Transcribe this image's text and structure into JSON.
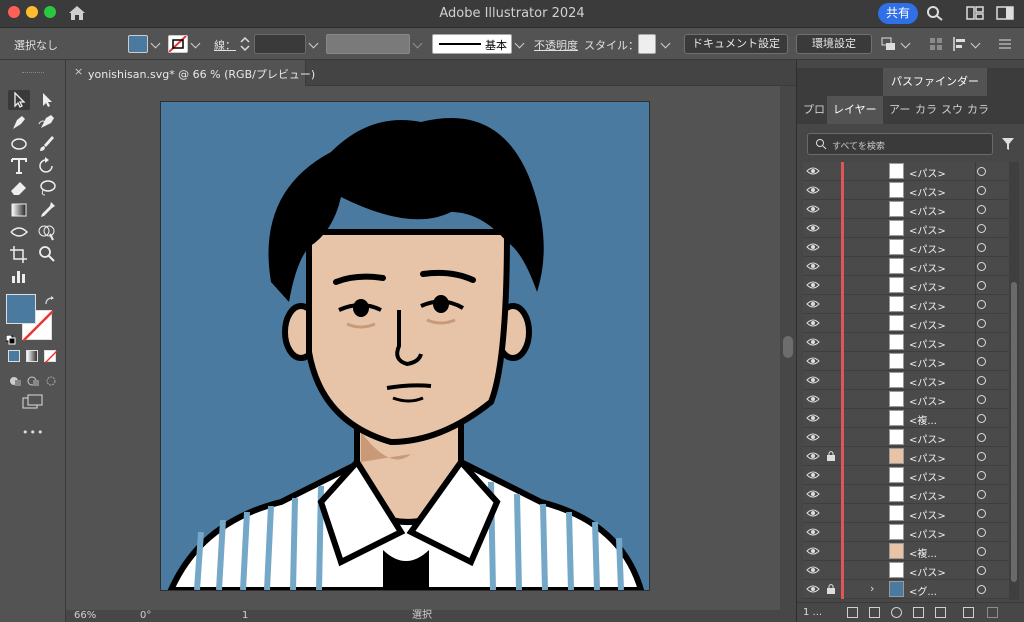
{
  "titlebar": {
    "app_title": "Adobe Illustrator 2024",
    "share_label": "共有",
    "traffic_colors": [
      "#ff5f57",
      "#febc2e",
      "#28c840"
    ]
  },
  "control_bar": {
    "selection": "選択なし",
    "fill_color": "#4b7aa0",
    "stroke_label": "線：",
    "stroke_profile": "基本",
    "opacity_label": "不透明度",
    "style_label": "スタイル：",
    "doc_setup_button": "ドキュメント設定",
    "prefs_button": "環境設定"
  },
  "document": {
    "tab_title": "yonishisan.svg* @ 66 % (RGB/プレビュー)",
    "close_symbol": "×",
    "zoom": "66%",
    "rotation": "0°",
    "artboard_number": "1",
    "status_text": "選択",
    "artboard_color": "#4b7aa0"
  },
  "toolbar": {
    "fill_swatch": "#4b7aa0",
    "more_symbol": "•••",
    "tools": [
      "selection-tool",
      "direct-selection-tool",
      "pen-tool",
      "curvature-tool",
      "ellipse-tool",
      "paintbrush-tool",
      "type-tool",
      "rotate-tool",
      "eraser-tool",
      "lasso-tool",
      "gradient-tool",
      "eyedropper-tool",
      "width-tool",
      "shape-builder-tool",
      "crop-tool",
      "zoom-tool",
      "graph-tool"
    ]
  },
  "right_panel": {
    "tabs_row1": [
      "パスファインダー"
    ],
    "tabs_row2": [
      "プロ",
      "レイヤー",
      "アー",
      "カラ",
      "スウ",
      "カラ"
    ],
    "active_tab": "レイヤー",
    "search_placeholder": "すべてを検索",
    "bottom_text": "1 ...",
    "layers": [
      {
        "name": "<パス>",
        "locked": false,
        "thumb": "white",
        "expand": false
      },
      {
        "name": "<パス>",
        "locked": false,
        "thumb": "white",
        "expand": false
      },
      {
        "name": "<パス>",
        "locked": false,
        "thumb": "white",
        "expand": false
      },
      {
        "name": "<パス>",
        "locked": false,
        "thumb": "white",
        "expand": false
      },
      {
        "name": "<パス>",
        "locked": false,
        "thumb": "white",
        "expand": false
      },
      {
        "name": "<パス>",
        "locked": false,
        "thumb": "white",
        "expand": false
      },
      {
        "name": "<パス>",
        "locked": false,
        "thumb": "white",
        "expand": false
      },
      {
        "name": "<パス>",
        "locked": false,
        "thumb": "white",
        "expand": false
      },
      {
        "name": "<パス>",
        "locked": false,
        "thumb": "white",
        "expand": false
      },
      {
        "name": "<パス>",
        "locked": false,
        "thumb": "white",
        "expand": false
      },
      {
        "name": "<パス>",
        "locked": false,
        "thumb": "white",
        "expand": false
      },
      {
        "name": "<パス>",
        "locked": false,
        "thumb": "white",
        "expand": false
      },
      {
        "name": "<パス>",
        "locked": false,
        "thumb": "white",
        "expand": false
      },
      {
        "name": "<複...",
        "locked": false,
        "thumb": "sketch",
        "expand": false
      },
      {
        "name": "<パス>",
        "locked": false,
        "thumb": "white",
        "expand": false
      },
      {
        "name": "<パス>",
        "locked": true,
        "thumb": "skin",
        "expand": false
      },
      {
        "name": "<パス>",
        "locked": false,
        "thumb": "sketch",
        "expand": false
      },
      {
        "name": "<パス>",
        "locked": false,
        "thumb": "sketch",
        "expand": false
      },
      {
        "name": "<パス>",
        "locked": false,
        "thumb": "line",
        "expand": false
      },
      {
        "name": "<パス>",
        "locked": false,
        "thumb": "line",
        "expand": false
      },
      {
        "name": "<複...",
        "locked": false,
        "thumb": "skin",
        "expand": false
      },
      {
        "name": "<パス>",
        "locked": false,
        "thumb": "line",
        "expand": false
      },
      {
        "name": "<グ...",
        "locked": true,
        "thumb": "blue",
        "expand": true
      }
    ]
  }
}
